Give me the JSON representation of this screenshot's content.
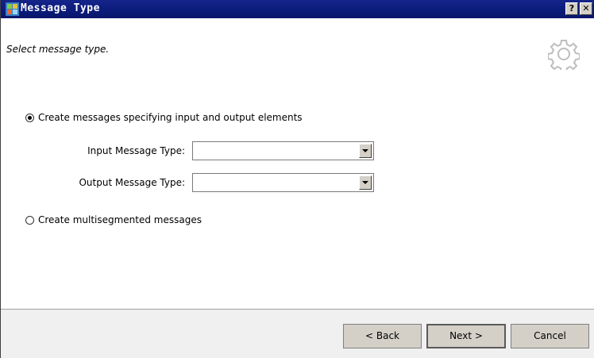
{
  "window": {
    "title": "Message Type",
    "help_label": "?",
    "close_label": "✕"
  },
  "header": {
    "subtitle": "Select message type."
  },
  "options": {
    "specify_label": "Create messages specifying input and output elements",
    "specify_checked": true,
    "multisegment_label": "Create multisegmented messages",
    "multisegment_checked": false
  },
  "fields": {
    "input_label": "Input Message Type:",
    "input_value": "",
    "output_label": "Output Message Type:",
    "output_value": ""
  },
  "buttons": {
    "back": "< Back",
    "next": "Next >",
    "cancel": "Cancel"
  },
  "icons": {
    "app": "app-icon",
    "gear": "gear-icon",
    "help": "help-icon",
    "close": "close-icon",
    "dropdown": "chevron-down-icon"
  }
}
